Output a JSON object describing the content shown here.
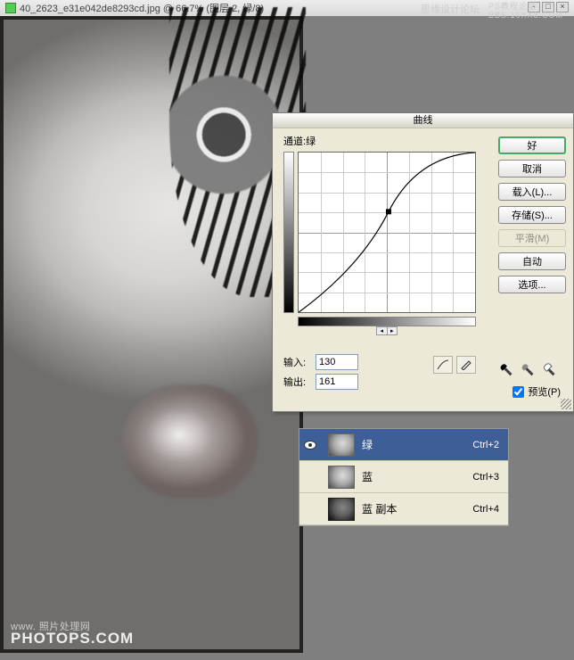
{
  "titlebar": {
    "filename": "40_2623_e31e042de8293cd.jpg @ 66.7% (图层 2, 绿/8)"
  },
  "window_buttons": {
    "min": "-",
    "max": "□",
    "close": "×"
  },
  "watermarks": {
    "top_left": "思缘设计论坛",
    "top_right": "PS教程论坛\nBBS.16XX8.COM",
    "photo_small": "www. 照片处理网",
    "photo_big": "PHOTOPS.COM"
  },
  "curves": {
    "title": "曲线",
    "channel_label": "通道:",
    "channel_value": "绿",
    "input_label": "输入:",
    "input_value": "130",
    "output_label": "输出:",
    "output_value": "161",
    "buttons": {
      "ok": "好",
      "cancel": "取消",
      "load": "载入(L)...",
      "save": "存储(S)...",
      "smooth": "平滑(M)",
      "auto": "自动",
      "options": "选项..."
    },
    "preview_label": "预览(P)",
    "preview_checked": true
  },
  "chart_data": {
    "type": "line",
    "title": "曲线",
    "xlabel": "输入",
    "ylabel": "输出",
    "xlim": [
      0,
      255
    ],
    "ylim": [
      0,
      255
    ],
    "grid": true,
    "series": [
      {
        "name": "绿",
        "points": [
          [
            0,
            0
          ],
          [
            130,
            161
          ],
          [
            255,
            255
          ]
        ]
      }
    ],
    "marker": {
      "x": 130,
      "y": 161
    }
  },
  "channels": {
    "items": [
      {
        "name": "绿",
        "shortcut": "Ctrl+2",
        "visible": true,
        "selected": true
      },
      {
        "name": "蓝",
        "shortcut": "Ctrl+3",
        "visible": false,
        "selected": false
      },
      {
        "name": "蓝 副本",
        "shortcut": "Ctrl+4",
        "visible": false,
        "selected": false
      }
    ]
  }
}
